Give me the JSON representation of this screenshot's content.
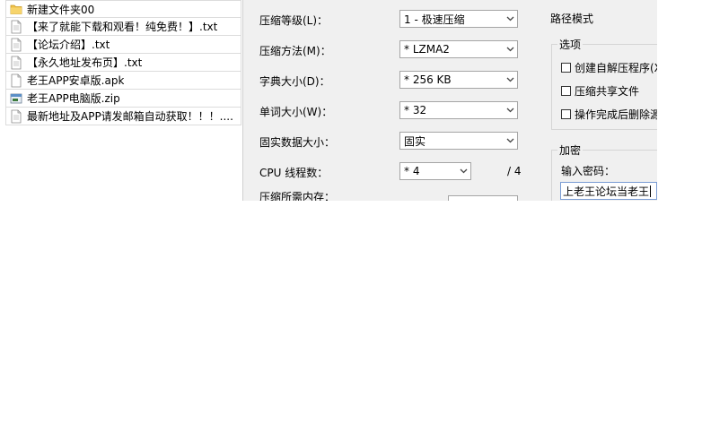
{
  "file_list": [
    {
      "icon": "folder-icon",
      "name": "新建文件夹00"
    },
    {
      "icon": "text-file-icon",
      "name": "【来了就能下载和观看！纯免费！】.txt"
    },
    {
      "icon": "text-file-icon",
      "name": "【论坛介绍】.txt"
    },
    {
      "icon": "text-file-icon",
      "name": "【永久地址发布页】.txt"
    },
    {
      "icon": "file-icon",
      "name": "老王APP安卓版.apk"
    },
    {
      "icon": "zip-file-icon",
      "name": "老王APP电脑版.zip"
    },
    {
      "icon": "text-file-icon",
      "name": "最新地址及APP请发邮箱自动获取！！！...."
    }
  ],
  "compression": {
    "level_label": "压缩等级(L)：",
    "level_value": "1 - 极速压缩",
    "method_label": "压缩方法(M)：",
    "method_value": "* LZMA2",
    "dict_label": "字典大小(D)：",
    "dict_value": "* 256 KB",
    "word_label": "单词大小(W)：",
    "word_value": "* 32",
    "solid_label": "固实数据大小：",
    "solid_value": "固实",
    "cpu_label": "CPU 线程数：",
    "cpu_value": "* 4",
    "cpu_max": "/ 4",
    "memory_label": "压缩所需内存："
  },
  "right_panel": {
    "path_mode_label": "路径模式",
    "options_title": "选项",
    "options": [
      {
        "label": "创建自解压程序(X",
        "checked": false
      },
      {
        "label": "压缩共享文件",
        "checked": false
      },
      {
        "label": "操作完成后删除源",
        "checked": false
      }
    ],
    "encryption_title": "加密",
    "password_label": "输入密码：",
    "password_value": "上老王论坛当老王"
  }
}
